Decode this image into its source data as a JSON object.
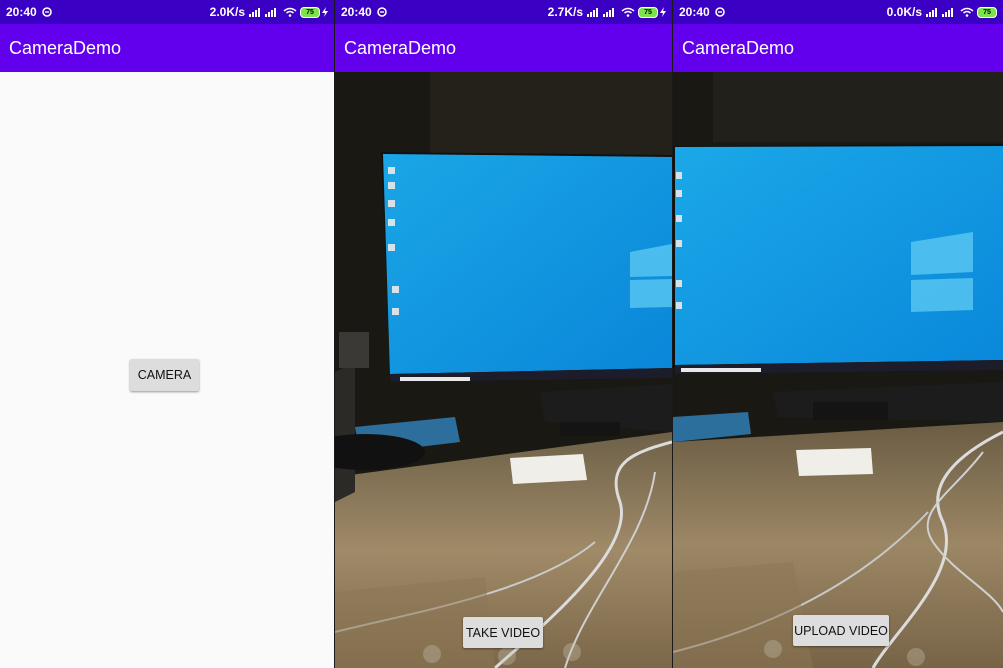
{
  "status_bars": [
    {
      "time": "20:40",
      "speed": "2.0K/s",
      "battery": "75"
    },
    {
      "time": "20:40",
      "speed": "2.7K/s",
      "battery": "75"
    },
    {
      "time": "20:40",
      "speed": "0.0K/s",
      "battery": "75"
    }
  ],
  "app_title": "CameraDemo",
  "screens": {
    "main": {
      "camera_button": "CAMERA"
    },
    "camera_preview": {
      "take_video_button": "TAKE VIDEO"
    },
    "camera_preview_recorded": {
      "upload_video_button": "UPLOAD VIDEO"
    }
  },
  "status_icons": {
    "sync": "sync-icon",
    "signal": "signal-icon",
    "wifi": "wifi-icon",
    "charging": "charging-bolt-icon"
  },
  "colors": {
    "status_bar": "#3a00c4",
    "app_bar": "#6200ee",
    "button": "#dddddd"
  }
}
